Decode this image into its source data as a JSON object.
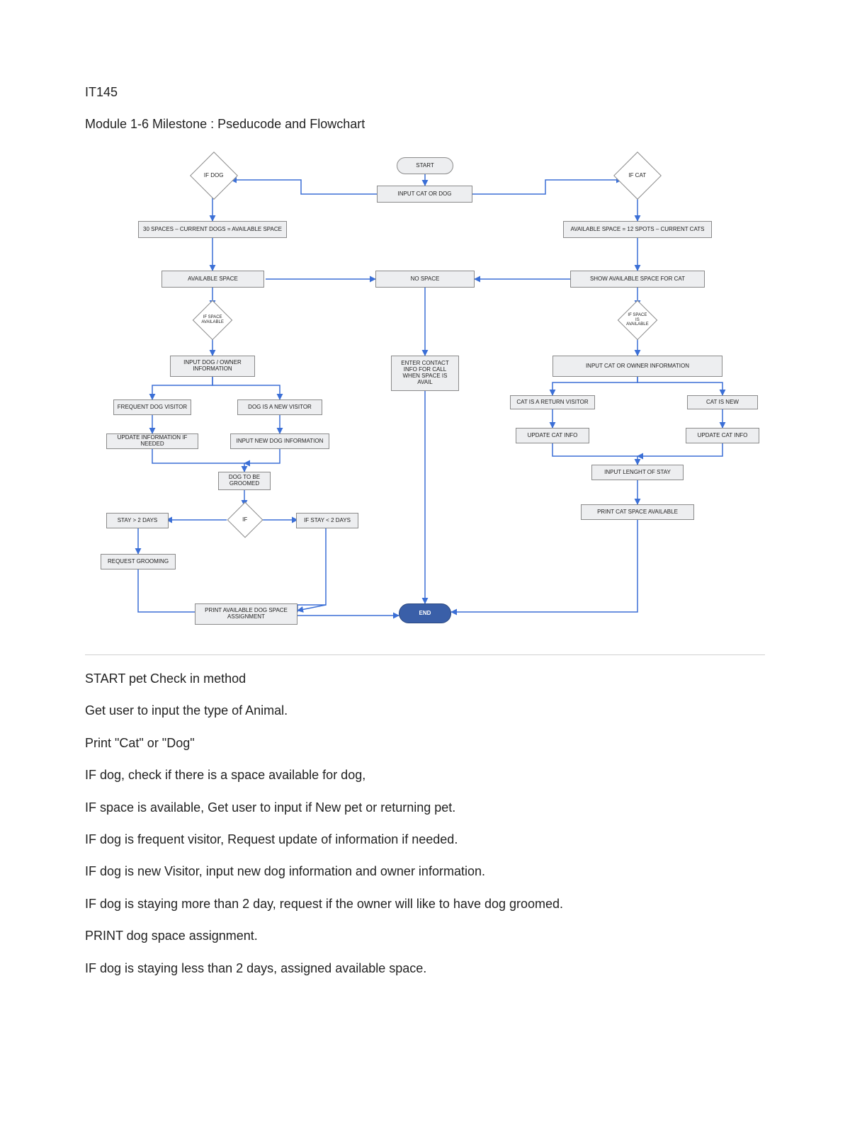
{
  "header": {
    "course_code": "IT145",
    "title": "Module 1-6 Milestone : Pseducode and Flowchart"
  },
  "flowchart": {
    "start": "START",
    "input_cat_or_dog": "INPUT CAT OR DOG",
    "if_dog": "IF DOG",
    "if_cat": "IF CAT",
    "dog_spaces_calc": "30 SPACES – CURRENT DOGS = AVAILABLE SPACE",
    "cat_spaces_calc": "AVAILABLE SPACE = 12 SPOTS – CURRENT CATS",
    "available_space": "AVAILABLE SPACE",
    "no_space": "NO SPACE",
    "show_cat_space": "SHOW AVAILABLE SPACE FOR CAT",
    "if_space_avail_dog": "IF SPACE AVAILABLE",
    "if_space_avail_cat": "IF SPACE IS AVAILABLE",
    "input_dog_owner": "INPUT DOG / OWNER INFORMATION",
    "enter_contact": "ENTER CONTACT INFO FOR CALL WHEN SPACE IS AVAIL",
    "input_cat_owner": "INPUT CAT OR OWNER INFORMATION",
    "freq_dog_visitor": "FREQUENT DOG VISITOR",
    "dog_new_visitor": "DOG IS A NEW VISITOR",
    "cat_return_visitor": "CAT IS A RETURN VISITOR",
    "cat_is_new": "CAT IS NEW",
    "update_info": "UPDATE INFORMATION IF NEEDED",
    "input_new_dog_info": "INPUT NEW DOG INFORMATION",
    "update_cat_info": "UPDATE CAT INFO",
    "update_cat_info2": "UPDATE CAT INFO",
    "dog_to_groom": "DOG TO BE GROOMED",
    "if_label": "IF",
    "stay_gt_2": "STAY > 2 DAYS",
    "if_stay_lt_2": "IF STAY < 2 DAYS",
    "request_grooming": "REQUEST GROOMING",
    "print_dog_space": "PRINT AVAILABLE DOG SPACE ASSIGNMENT",
    "input_length_stay": "INPUT LENGHT OF STAY",
    "print_cat_space": "PRINT CAT SPACE AVAILABLE",
    "end": "END"
  },
  "pseudocode": [
    "START pet Check in method",
    "Get user to input the type of Animal.",
    "Print \"Cat\" or \"Dog\"",
    "IF dog, check if there is a space available for dog,",
    "IF space is available, Get user to input if New pet or returning pet.",
    "IF dog is frequent visitor, Request update of information if needed.",
    "IF dog is new Visitor, input new dog information and owner information.",
    "IF dog is staying more than 2 day, request if the owner will like to have dog groomed.",
    "PRINT dog space assignment.",
    "IF dog is staying less than 2 days, assigned available space."
  ]
}
